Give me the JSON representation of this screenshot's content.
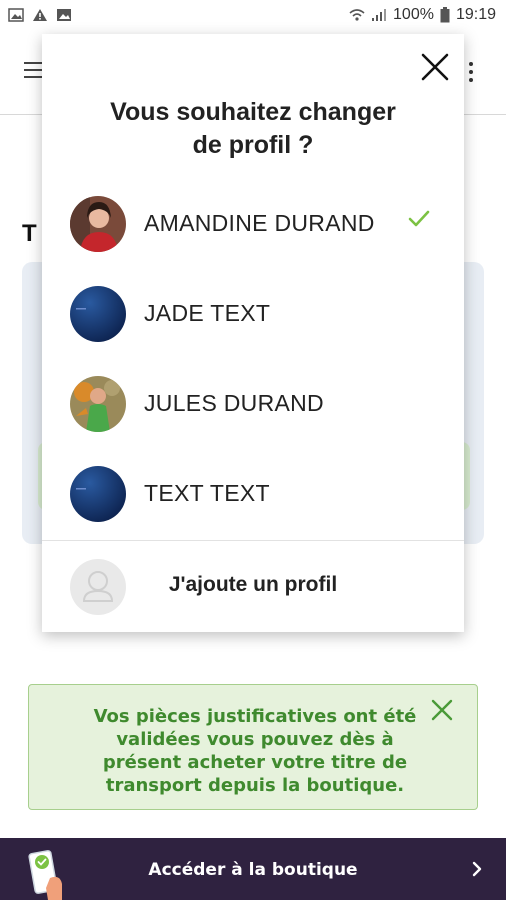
{
  "status_bar": {
    "battery": "100%",
    "time": "19:19"
  },
  "background": {
    "section_initial": "T"
  },
  "modal": {
    "title_line1": "Vous souhaitez changer",
    "title_line2": "de profil ?",
    "profiles": [
      {
        "name": "AMANDINE DURAND",
        "avatar": "photo-woman",
        "selected": true
      },
      {
        "name": "JADE TEXT",
        "avatar": "blue-placeholder",
        "selected": false
      },
      {
        "name": "JULES DURAND",
        "avatar": "photo-child",
        "selected": false
      },
      {
        "name": "TEXT TEXT",
        "avatar": "blue-placeholder",
        "selected": false
      }
    ],
    "add_profile_label": "J'ajoute un profil"
  },
  "notice": {
    "text": "Vos pièces justificatives ont été validées vous pouvez dès à présent acheter votre titre de transport depuis la boutique."
  },
  "bottom_bar": {
    "label": "Accéder à la boutique"
  },
  "colors": {
    "check": "#7cc243",
    "notice_text": "#3f8a2e",
    "notice_bg": "#e6f2dc",
    "bottom_bar_bg": "#2f2240"
  }
}
